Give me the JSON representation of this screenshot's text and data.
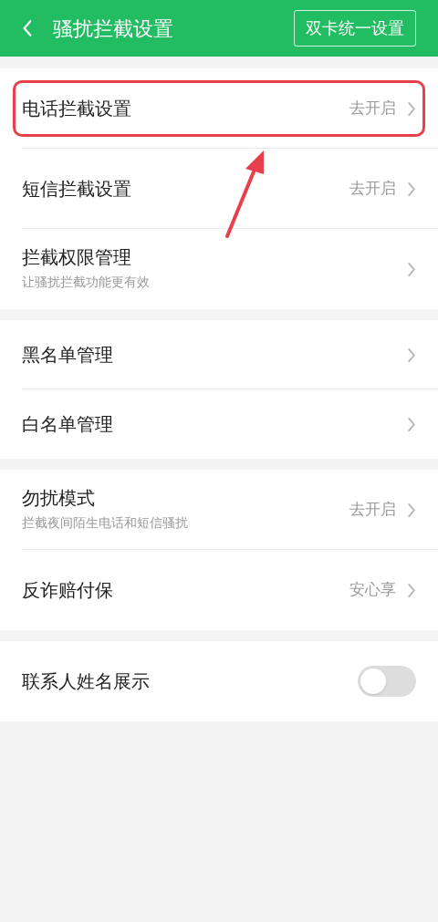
{
  "header": {
    "title": "骚扰拦截设置",
    "action": "双卡统一设置"
  },
  "groups": [
    {
      "rows": [
        {
          "kind": "link",
          "label": "电话拦截设置",
          "value": "去开启",
          "highlighted": true
        },
        {
          "kind": "link",
          "label": "短信拦截设置",
          "value": "去开启",
          "highlighted": false
        },
        {
          "kind": "link",
          "label": "拦截权限管理",
          "subtitle": "让骚扰拦截功能更有效",
          "highlighted": false
        }
      ]
    },
    {
      "rows": [
        {
          "kind": "link",
          "label": "黑名单管理",
          "highlighted": false
        },
        {
          "kind": "link",
          "label": "白名单管理",
          "highlighted": false
        }
      ]
    },
    {
      "rows": [
        {
          "kind": "link",
          "label": "勿扰模式",
          "subtitle": "拦截夜间陌生电话和短信骚扰",
          "value": "去开启",
          "highlighted": false
        },
        {
          "kind": "link",
          "label": "反诈赔付保",
          "value": "安心享",
          "highlighted": false
        }
      ]
    },
    {
      "rows": [
        {
          "kind": "toggle",
          "label": "联系人姓名展示",
          "on": false,
          "highlighted": false
        }
      ]
    }
  ]
}
